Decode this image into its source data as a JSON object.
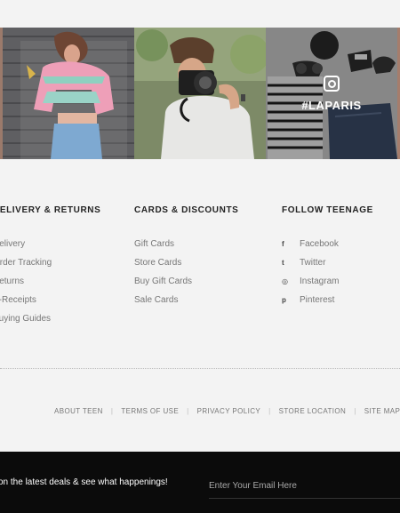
{
  "gallery": {
    "overlay_hashtag": "#LAPARIS",
    "overlay_icon": "instagram-icon"
  },
  "columns": [
    {
      "heading": "DELIVERY & RETURNS",
      "links": [
        "Delivery",
        "Order Tracking",
        "Returns",
        "E-Receipts",
        "Buying Guides"
      ]
    },
    {
      "heading": "CARDS & DISCOUNTS",
      "links": [
        "Gift Cards",
        "Store Cards",
        "Buy Gift Cards",
        "Sale Cards"
      ]
    },
    {
      "heading": "FOLLOW TEENAGE",
      "links": [
        {
          "icon": "facebook-icon",
          "label": "Facebook",
          "glyph": "f"
        },
        {
          "icon": "twitter-icon",
          "label": "Twitter",
          "glyph": "t"
        },
        {
          "icon": "instagram-icon",
          "label": "Instagram",
          "glyph": "◎"
        },
        {
          "icon": "pinterest-icon",
          "label": "Pinterest",
          "glyph": "p"
        }
      ]
    }
  ],
  "footer": {
    "links": [
      "ABOUT TEEN",
      "TERMS OF USE",
      "PRIVACY POLICY",
      "STORE LOCATION",
      "SITE MAP"
    ]
  },
  "newsletter": {
    "text": "on the latest deals & see what happenings!",
    "placeholder": "Enter Your Email Here"
  },
  "colors": {
    "background": "#f3f3f3",
    "newsletter_bg": "#0b0b0b"
  }
}
